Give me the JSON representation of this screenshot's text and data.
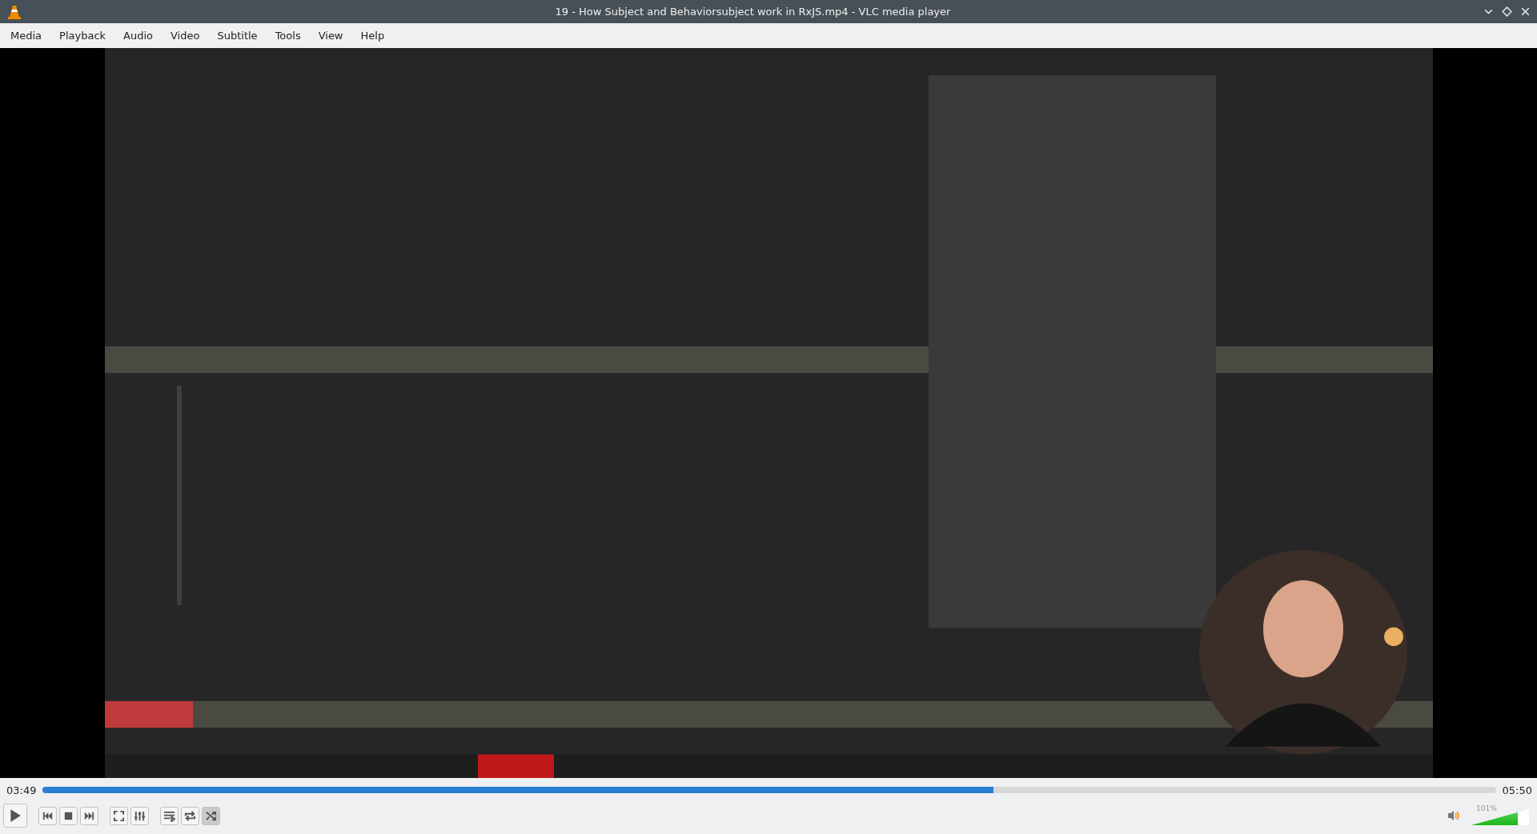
{
  "window": {
    "title": "19 - How Subject and Behaviorsubject work in RxJS.mp4 - VLC media player"
  },
  "menu": [
    "Media",
    "Playback",
    "Audio",
    "Video",
    "Subtitle",
    "Tools",
    "View",
    "Help"
  ],
  "video": {
    "kind": "picture"
  },
  "seek": {
    "elapsed": "03:49",
    "total": "05:50",
    "level": 0.654
  },
  "controls": [
    {
      "kind": "play",
      "selected": false
    },
    {
      "kind": "prev",
      "selected": false
    },
    {
      "kind": "stop",
      "selected": false
    },
    {
      "kind": "next",
      "selected": false
    },
    {
      "kind": "fullscreen",
      "selected": false
    },
    {
      "kind": "settings",
      "selected": false
    },
    {
      "kind": "playlist",
      "selected": false
    },
    {
      "kind": "loop",
      "selected": false
    },
    {
      "kind": "random",
      "selected": true
    }
  ],
  "volume": {
    "reading": "101%",
    "level": 0.81
  }
}
